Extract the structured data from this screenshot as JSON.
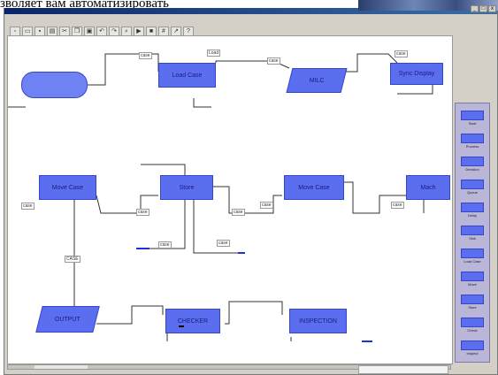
{
  "caption": "зволяет вам автоматизировать",
  "menu": [
    "",
    "",
    "",
    "",
    "",
    "",
    "",
    "",
    ""
  ],
  "window": {
    "ctrl_min": "_",
    "ctrl_max": "□",
    "ctrl_close": "x"
  },
  "nodes": {
    "start": "",
    "load_case": "Load Case",
    "milc": "MILC",
    "sync_display": "Sync Display",
    "move_case_left": "Move Case",
    "store": "Store",
    "move_case_mid": "Move Case",
    "mach": "Mach",
    "output": "OUTPUT",
    "checker": "CHECKER",
    "inspection": "INSPECTION"
  },
  "labels": {
    "l1": "case",
    "l2": "Load",
    "l3": "case",
    "l4": "case",
    "l5": "case",
    "l6": "case",
    "l7": "CASE",
    "l8": "case",
    "l9": "case",
    "l10": "case",
    "l11": "case",
    "l12": "case"
  },
  "palette": [
    "Start",
    "Process",
    "Decision",
    "Queue",
    "Delay",
    "Sink",
    "Load Case",
    "Move",
    "Store",
    "Check",
    "Inspect"
  ],
  "tooltip": ""
}
